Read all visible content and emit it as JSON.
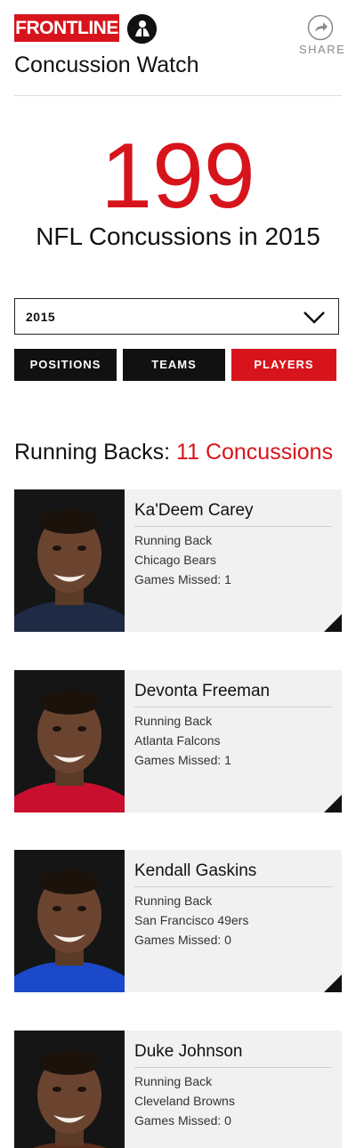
{
  "header": {
    "brand": "FRONTLINE",
    "title": "Concussion Watch",
    "share_label": "SHARE"
  },
  "summary": {
    "count": "199",
    "caption": "NFL Concussions in 2015"
  },
  "filter": {
    "selected_year": "2015"
  },
  "tabs": [
    {
      "label": "POSITIONS",
      "active": false
    },
    {
      "label": "TEAMS",
      "active": false
    },
    {
      "label": "PLAYERS",
      "active": true
    }
  ],
  "section": {
    "title": "Running Backs: ",
    "count_label": "11 Concussions"
  },
  "players": [
    {
      "name": "Ka'Deem Carey",
      "position": "Running Back",
      "team": "Chicago Bears",
      "games_missed": "Games Missed: 1",
      "jersey_color": "#1f2a44"
    },
    {
      "name": "Devonta Freeman",
      "position": "Running Back",
      "team": "Atlanta Falcons",
      "games_missed": "Games Missed: 1",
      "jersey_color": "#c8102e"
    },
    {
      "name": "Kendall Gaskins",
      "position": "Running Back",
      "team": "San Francisco 49ers",
      "games_missed": "Games Missed: 0",
      "jersey_color": "#1c49c9"
    },
    {
      "name": "Duke Johnson",
      "position": "Running Back",
      "team": "Cleveland Browns",
      "games_missed": "Games Missed: 0",
      "jersey_color": "#5a2d1a"
    }
  ],
  "colors": {
    "brand_red": "#d7141b",
    "dark": "#111111",
    "card_bg": "#f1f1f1"
  }
}
